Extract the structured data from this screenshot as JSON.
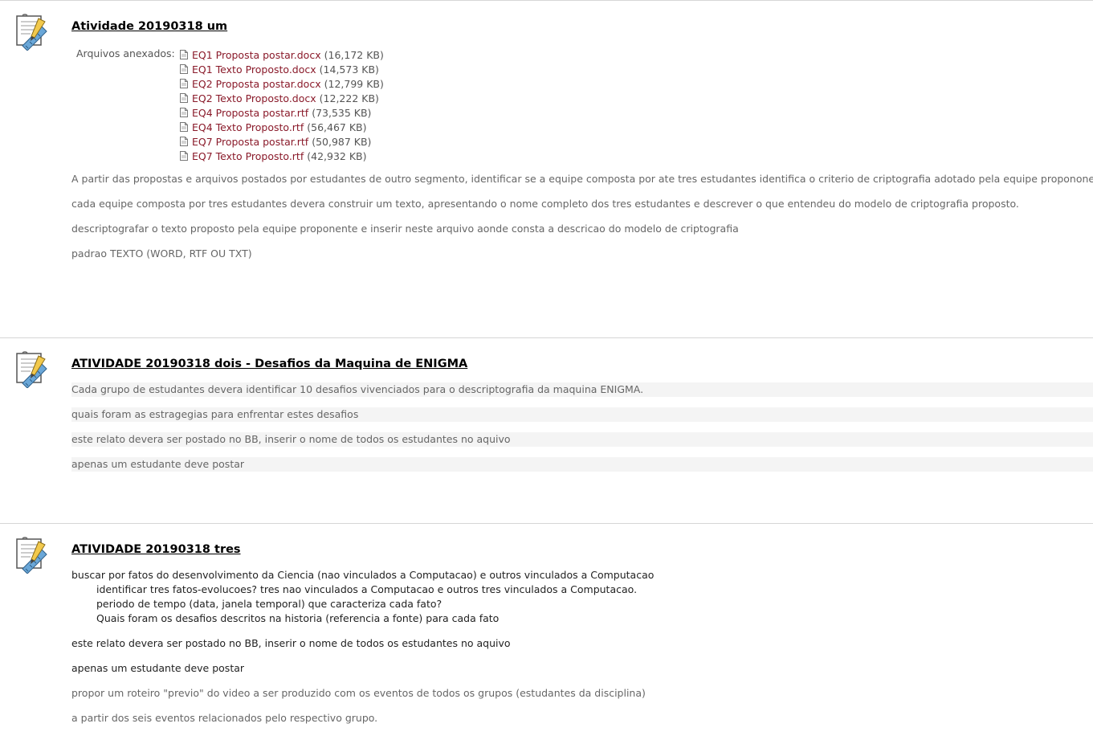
{
  "items": [
    {
      "title": "Atividade 20190318 um",
      "attachments_label": "Arquivos anexados:",
      "attachments": [
        {
          "name": "EQ1 Proposta postar.docx",
          "size": "(16,172 KB)"
        },
        {
          "name": "EQ1 Texto Proposto.docx",
          "size": "(14,573 KB)"
        },
        {
          "name": "EQ2 Proposta postar.docx",
          "size": "(12,799 KB)"
        },
        {
          "name": "EQ2 Texto Proposto.docx",
          "size": "(12,222 KB)"
        },
        {
          "name": "EQ4 Proposta postar.rtf",
          "size": "(73,535 KB)"
        },
        {
          "name": "EQ4 Texto Proposto.rtf",
          "size": "(56,467 KB)"
        },
        {
          "name": "EQ7 Proposta postar.rtf",
          "size": "(50,987 KB)"
        },
        {
          "name": "EQ7 Texto Proposto.rtf",
          "size": "(42,932 KB)"
        }
      ],
      "paragraphs": [
        "A partir das propostas e arquivos postados por estudantes de outro segmento, identificar se a equipe composta por ate tres estudantes identifica o criterio de criptografia adotado pela equipe propononente.",
        "cada equipe composta por tres estudantes devera construir um texto, apresentando o nome completo dos tres estudantes e descrever o que entendeu do modelo de criptografia proposto.",
        "descriptografar o texto proposto pela equipe proponente e inserir neste arquivo aonde consta a descricao do modelo de criptografia",
        "padrao TEXTO (WORD, RTF OU TXT)"
      ]
    },
    {
      "title": "ATIVIDADE 20190318 dois - Desafios da Maquina de ENIGMA",
      "paragraphs": [
        "Cada grupo de estudantes devera identificar 10 desafios vivenciados para o descriptografia da maquina ENIGMA.",
        "quais foram as estragegias para enfrentar estes desafios",
        "este relato devera ser postado no BB, inserir o nome de todos os estudantes no aquivo",
        "apenas um estudante deve postar"
      ]
    },
    {
      "title": "ATIVIDADE 20190318 tres",
      "intro": "buscar por fatos do desenvolvimento da Ciencia (nao vinculados a Computacao) e outros vinculados a Computacao",
      "subitems": [
        "identificar tres fatos-evolucoes? tres  nao vinculados a Computacao e outros tres vinculados a Computacao.",
        "periodo de tempo (data, janela temporal) que caracteriza cada fato?",
        "Quais foram os desafios descritos na historia (referencia a fonte) para cada fato"
      ],
      "paragraphs": [
        "este relato devera ser postado no BB, inserir o nome de todos os estudantes no aquivo",
        "apenas um estudante deve postar",
        "propor um roteiro \"previo\" do video a ser produzido com os eventos de todos os grupos (estudantes da disciplina)",
        "a partir dos seis eventos relacionados pelo respectivo grupo."
      ]
    }
  ]
}
